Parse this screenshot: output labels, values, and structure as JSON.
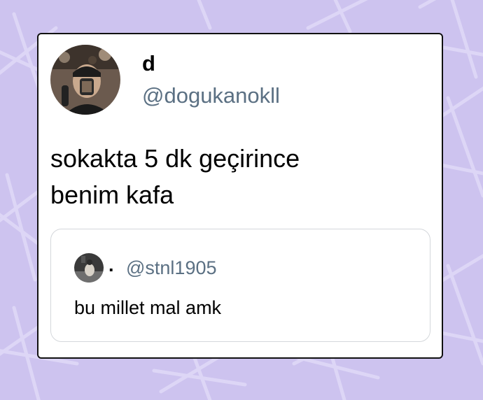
{
  "tweet": {
    "display_name": "d",
    "handle": "@dogukanokll",
    "text_line1": "sokakta 5 dk geçirince",
    "text_line2": "benim kafa"
  },
  "quoted_tweet": {
    "display_name": ".",
    "handle": "@stnl1905",
    "text": "bu millet mal amk"
  },
  "colors": {
    "background": "#cdc3ef",
    "handle_gray": "#5b7083"
  }
}
